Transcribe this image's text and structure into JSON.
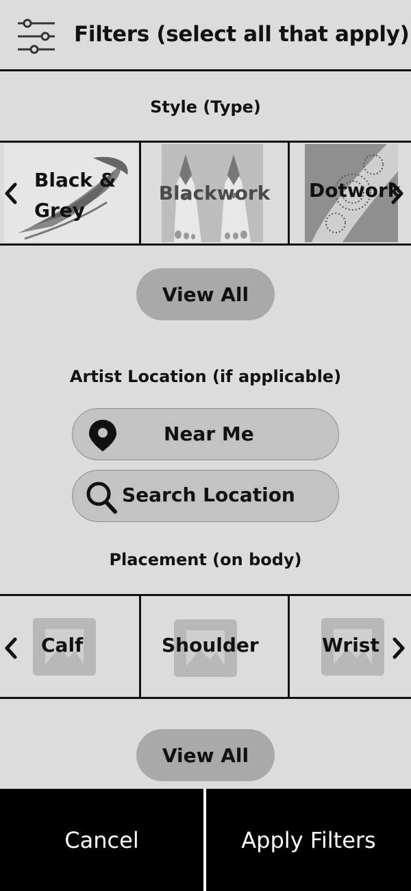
{
  "header": {
    "title": "Filters (select all that apply)",
    "icon": "sliders-icon"
  },
  "style_section": {
    "label": "Style (Type)",
    "tiles": [
      {
        "label": "Black & Grey",
        "image": "tattoo-photo-black-grey"
      },
      {
        "label": "Blackwork",
        "image": "tattoo-photo-blackwork"
      },
      {
        "label": "Dotwork",
        "image": "tattoo-photo-dotwork"
      }
    ],
    "view_all": "View All"
  },
  "location_section": {
    "label": "Artist Location (if applicable)",
    "near_me": "Near Me",
    "search_location": "Search Location"
  },
  "placement_section": {
    "label": "Placement (on body)",
    "tiles": [
      {
        "label": "Calf",
        "image": "image-placeholder-icon"
      },
      {
        "label": "Shoulder",
        "image": "image-placeholder-icon"
      },
      {
        "label": "Wrist",
        "image": "image-placeholder-icon"
      }
    ],
    "view_all": "View All"
  },
  "footer": {
    "cancel": "Cancel",
    "apply": "Apply Filters"
  },
  "colors": {
    "background": "#dcdcdc",
    "pill": "#a9a9a9",
    "location_button": "#c3c3c3",
    "footer": "#000000"
  }
}
